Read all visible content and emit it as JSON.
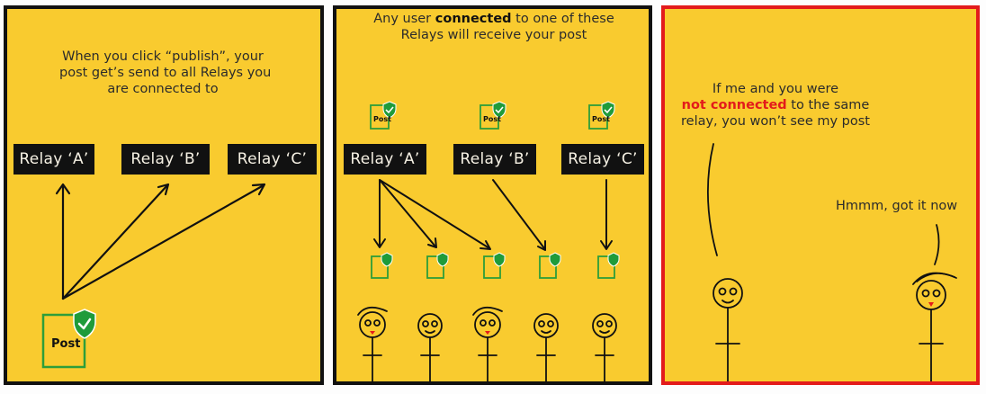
{
  "panel1": {
    "caption": [
      "When you click “publish”, your",
      "post get’s send to all Relays you",
      "are connected to"
    ],
    "relays": [
      "Relay ‘A’",
      "Relay ‘B’",
      "Relay ‘C’"
    ],
    "post_label": "Post"
  },
  "panel2": {
    "caption": {
      "line1_pre": "Any user ",
      "line1_bold": "connected",
      "line1_post": " to one of these",
      "line2": "Relays will receive your post"
    },
    "relays": [
      "Relay ‘A’",
      "Relay ‘B’",
      "Relay ‘C’"
    ],
    "post_label": "Post"
  },
  "panel3": {
    "speech": {
      "line1": "If me and you were",
      "line2_red": "not connected",
      "line2_post": " to the same",
      "line3": "relay, you won’t see my post"
    },
    "reply": "Hmmm, got it now"
  },
  "colors": {
    "panel_bg": "#f9cb2f",
    "border": "#111111",
    "highlight_border": "#e31b1b",
    "doc_green": "#2e9e3a",
    "shield_green": "#1f9b3a"
  },
  "icons": [
    "document-icon",
    "shield-check-icon",
    "stick-figure",
    "arrow"
  ]
}
